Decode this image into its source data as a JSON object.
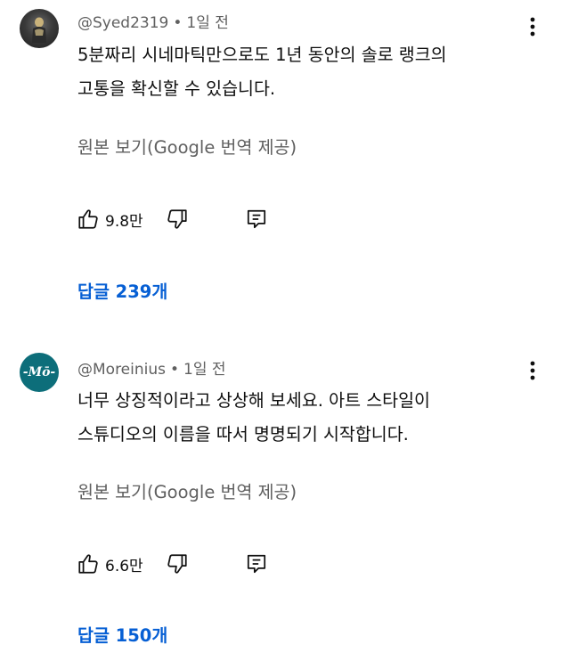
{
  "comments": [
    {
      "author": "@Syed2319",
      "time": "1일 전",
      "lines": [
        "5분짜리 시네마틱만으로도 1년 동안의 솔로 랭크의",
        "고통을 확신할 수 있습니다."
      ],
      "translate_label": "원본 보기(Google 번역 제공)",
      "likes": "9.8만",
      "replies_label": "답글 239개"
    },
    {
      "author": "@Moreinius",
      "time": "1일 전",
      "avatar_text": "-Mō-",
      "lines": [
        "너무 상징적이라고 상상해 보세요. 아트 스타일이",
        "스튜디오의 이름을 따서 명명되기 시작합니다."
      ],
      "translate_label": "원본 보기(Google 번역 제공)",
      "likes": "6.6만",
      "replies_label": "답글 150개"
    }
  ],
  "icons": {
    "like": "thumbs-up-icon",
    "dislike": "thumbs-down-icon",
    "reply": "reply-icon",
    "more": "more-vert-icon"
  },
  "colors": {
    "link": "#065fd4",
    "secondary_text": "#606060",
    "logo_bg": "#0d6e7a"
  }
}
